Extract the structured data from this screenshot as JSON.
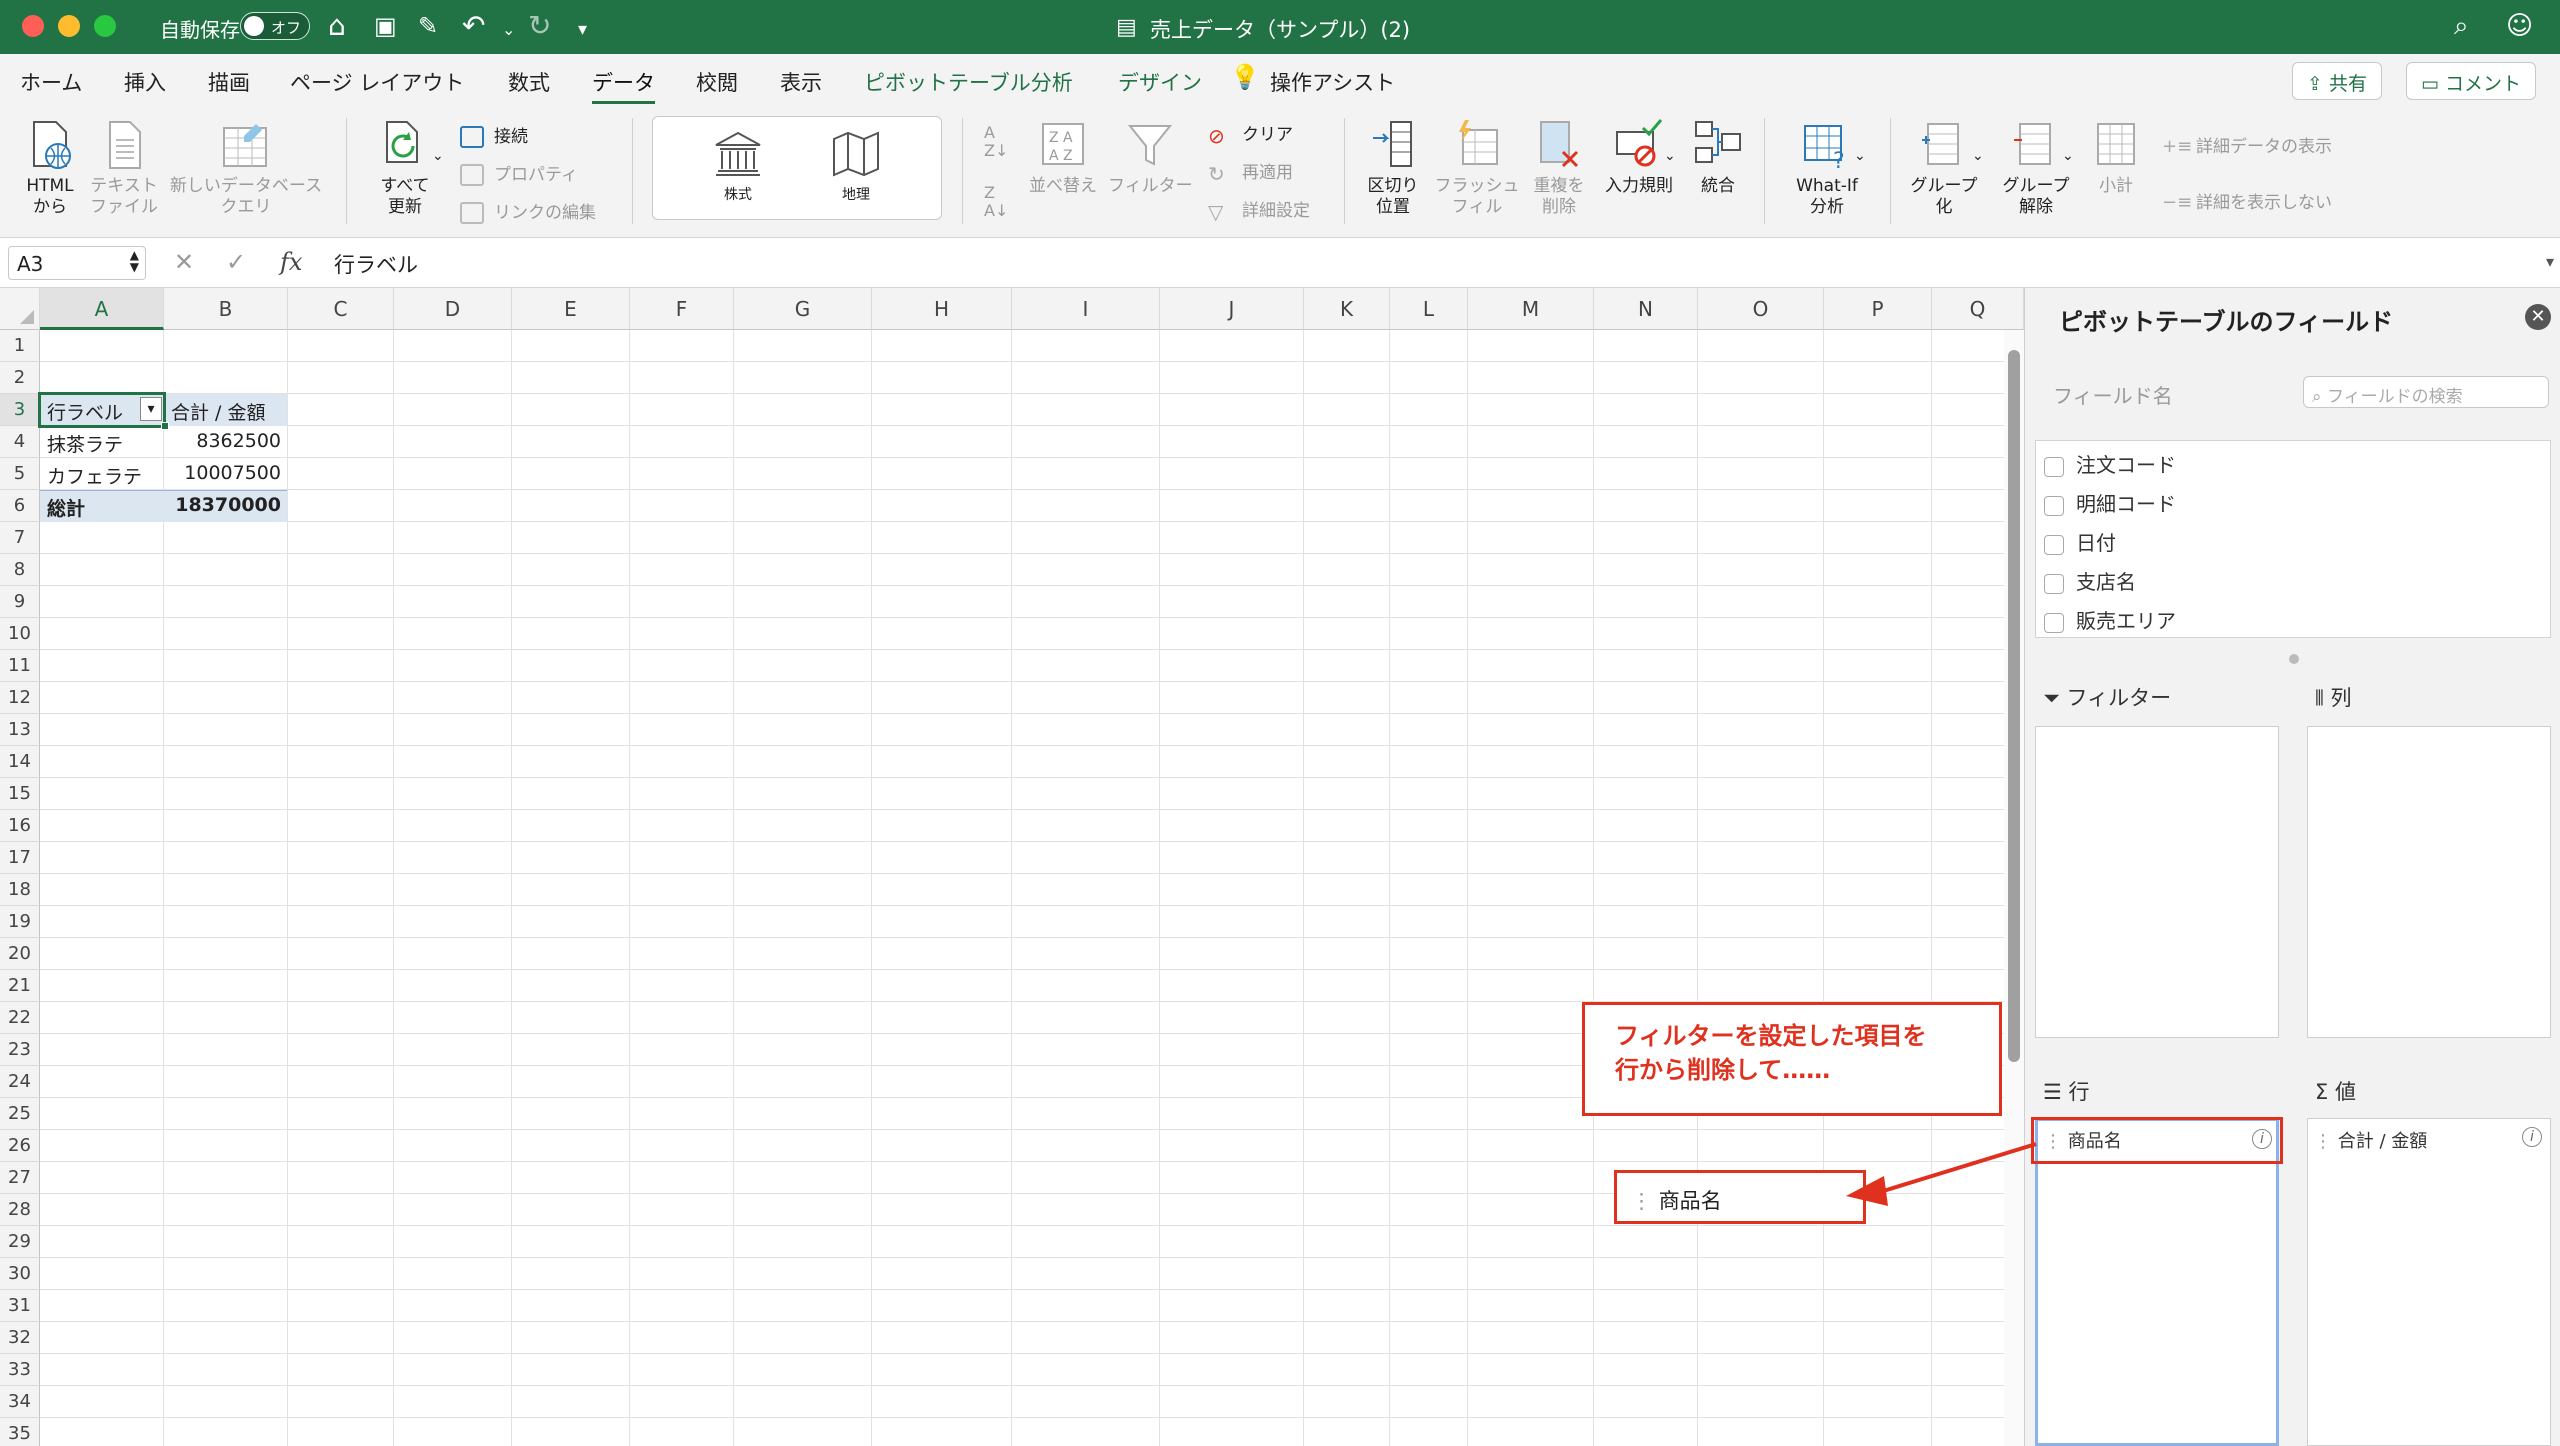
{
  "window": {
    "title": "売上データ（サンプル）(2)",
    "autosave_label": "自動保存",
    "autosave_state": "オフ"
  },
  "menu": {
    "items": [
      "ホーム",
      "挿入",
      "描画",
      "ページ レイアウト",
      "数式",
      "データ",
      "校閲",
      "表示",
      "ピボットテーブル分析",
      "デザイン"
    ],
    "assist": "操作アシスト",
    "share": "共有",
    "comment": "コメント",
    "active_index": 5
  },
  "ribbon": {
    "html_from": [
      "HTML",
      "から"
    ],
    "text_file": [
      "テキスト",
      "ファイル"
    ],
    "new_db_query": [
      "新しいデータベース",
      "クエリ"
    ],
    "refresh_all": [
      "すべて",
      "更新"
    ],
    "connections": "接続",
    "properties": "プロパティ",
    "edit_links": "リンクの編集",
    "stocks": "株式",
    "geography": "地理",
    "sort": "並べ替え",
    "filter": "フィルター",
    "clear": "クリア",
    "reapply": "再適用",
    "advanced": "詳細設定",
    "text_to_columns": [
      "区切り",
      "位置"
    ],
    "flash_fill": [
      "フラッシュ",
      "フィル"
    ],
    "remove_duplicates": [
      "重複を",
      "削除"
    ],
    "data_validation": "入力規則",
    "consolidate": "統合",
    "whatif": [
      "What-If",
      "分析"
    ],
    "group": [
      "グループ",
      "化"
    ],
    "ungroup": [
      "グループ",
      "解除"
    ],
    "subtotal": "小計",
    "show_detail": "詳細データの表示",
    "hide_detail": "詳細を表示しない"
  },
  "formula_bar": {
    "cell_ref": "A3",
    "content": "行ラベル",
    "fx": "fx"
  },
  "sheet": {
    "columns": [
      "A",
      "B",
      "C",
      "D",
      "E",
      "F",
      "G",
      "H",
      "I",
      "J",
      "K",
      "L",
      "M",
      "N",
      "O",
      "P",
      "Q"
    ],
    "row_count": 35,
    "pivot": {
      "header_label": "行ラベル",
      "header_value": "合計 / 金額",
      "rows": [
        {
          "label": "抹茶ラテ",
          "value": "8362500"
        },
        {
          "label": "カフェラテ",
          "value": "10007500"
        }
      ],
      "total_label": "総計",
      "total_value": "18370000"
    }
  },
  "pivot_pane": {
    "title": "ピボットテーブルのフィールド",
    "field_name_label": "フィールド名",
    "search_placeholder": "フィールドの検索",
    "fields": [
      "注文コード",
      "明細コード",
      "日付",
      "支店名",
      "販売エリア"
    ],
    "filters_label": "フィルター",
    "columns_label": "列",
    "rows_label": "行",
    "values_label": "値",
    "rows_items": [
      "商品名"
    ],
    "values_items": [
      "合計 / 金額"
    ]
  },
  "annotation": {
    "callout_line1": "フィルターを設定した項目を",
    "callout_line2": "行から削除して……",
    "dragged_field": "商品名",
    "color": "#e0301e"
  },
  "colors": {
    "brand": "#217346",
    "pivot_header": "#dce6f1"
  }
}
